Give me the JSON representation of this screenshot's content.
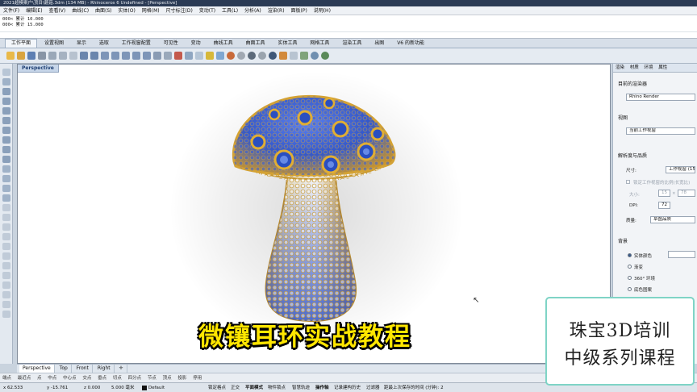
{
  "window": {
    "title": "2021超模案户\\顶目\\蘑菇.3dm (134 MB) - Rhinoceros 6 Undefined - [Perspective]"
  },
  "menu": [
    "文件(F)",
    "编辑(E)",
    "查看(V)",
    "曲线(C)",
    "曲面(S)",
    "实体(O)",
    "网格(M)",
    "尺寸标注(D)",
    "变动(T)",
    "工具(L)",
    "分析(A)",
    "渲染(R)",
    "面板(P)",
    "说明(H)"
  ],
  "command_history": [
    "000< 累计 10.000",
    "000< 累计 15.000"
  ],
  "toolbar_tabs": [
    "工作平面",
    "设置视图",
    "显示",
    "选取",
    "工作视窗配置",
    "可见性",
    "变动",
    "曲线工具",
    "曲面工具",
    "实体工具",
    "网格工具",
    "渲染工具",
    "出图",
    "V6 的新功能"
  ],
  "toolbar_active_tab": "工作平面",
  "viewport": {
    "label": "Perspective",
    "caption": "微镶耳环实战教程"
  },
  "right_panel": {
    "tabs": [
      "渲染",
      "材质",
      "环境",
      "属性"
    ],
    "target_renderer_heading": "目前的渲染器",
    "renderer": "Rhino Render",
    "view_heading": "视图",
    "view_value": "当前工作视窗",
    "resolution_heading": "解析度与品质",
    "size_label": "尺寸:",
    "size_value": "工作视窗 (1535",
    "lock_label": "锁定工作视窗的比例(长宽比)",
    "dims_label": "大小:",
    "width": "15",
    "height": "78",
    "dpi_label": "DPI:",
    "dpi_value": "72",
    "quality_label": "质量:",
    "quality_value": "草图品质",
    "background_heading": "背景",
    "bg_options": [
      "实体颜色",
      "渐变",
      "360° 环境",
      "底色图案"
    ],
    "bg_selected": 0
  },
  "view_tabs": [
    "Perspective",
    "Top",
    "Front",
    "Right"
  ],
  "view_tabs_active": "Perspective",
  "osnaps": [
    "端点",
    "最近点",
    "点",
    "中点",
    "中心点",
    "交点",
    "垂点",
    "切点",
    "四分点",
    "节点",
    "顶点",
    "投影",
    "停用"
  ],
  "status": {
    "x": "x 62.533",
    "y": "y -15.761",
    "z": "z 0.000",
    "units": "5.000 毫米",
    "layer": "Default",
    "items": [
      "锁定格点",
      "正交",
      "平面模式",
      "物件锁点",
      "智慧轨迹",
      "操作轴",
      "记录建构历史",
      "过滤器",
      "距最上次保存的时间 (分钟): 2"
    ]
  },
  "promo": {
    "line1": "珠宝3D培训",
    "line2": "中级系列课程"
  },
  "colors": {
    "gold": "#d9a323",
    "sapphire": "#2f56c9",
    "diamond": "#eef1f7",
    "caption_yellow": "#ffe600",
    "promo_border": "#7fd4c6",
    "viewport_label_bg": "#c7d6e9"
  }
}
